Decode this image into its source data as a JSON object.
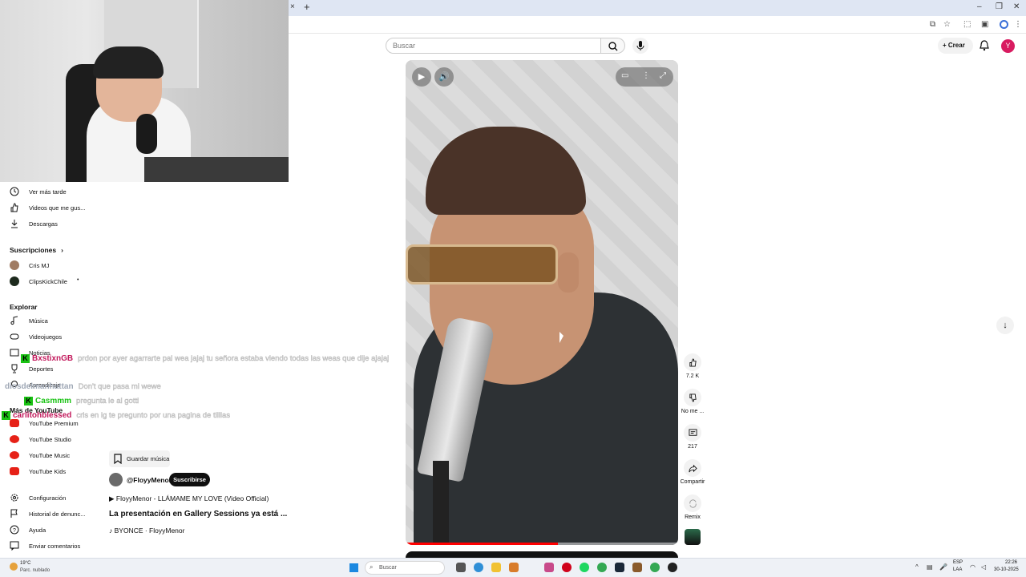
{
  "browser": {
    "close_tab_glyph": "×",
    "new_tab_glyph": "+"
  },
  "header": {
    "search_placeholder": "Buscar",
    "create_label": "Crear",
    "avatar_letter": "Y"
  },
  "sidebar": {
    "personal_items": [
      {
        "label": "Ver más tarde",
        "icon": "clock-icon"
      },
      {
        "label": "Videos que me gus...",
        "icon": "thumbs-up-icon"
      },
      {
        "label": "Descargas",
        "icon": "download-icon"
      }
    ],
    "subscriptions_heading": "Suscripciones",
    "subscriptions": [
      {
        "label": "Cris MJ"
      },
      {
        "label": "ClipsKickChile"
      }
    ],
    "explore_heading": "Explorar",
    "explore_items": [
      {
        "label": "Música",
        "icon": "music-note-icon"
      },
      {
        "label": "Videojuegos",
        "icon": "gamepad-icon"
      },
      {
        "label": "Noticias",
        "icon": "news-icon"
      },
      {
        "label": "Deportes",
        "icon": "trophy-icon"
      },
      {
        "label": "Aprendizaje",
        "icon": "lightbulb-icon"
      }
    ],
    "more_heading": "Más de YouTube",
    "more_items": [
      {
        "label": "YouTube Premium"
      },
      {
        "label": "YouTube Studio"
      },
      {
        "label": "YouTube Music"
      },
      {
        "label": "YouTube Kids"
      }
    ],
    "footer_items": [
      {
        "label": "Configuración",
        "icon": "gear-icon"
      },
      {
        "label": "Historial de denunc...",
        "icon": "flag-icon"
      },
      {
        "label": "Ayuda",
        "icon": "help-icon"
      },
      {
        "label": "Enviar comentarios",
        "icon": "feedback-icon"
      }
    ]
  },
  "chat": [
    {
      "user": "BxstixnGB",
      "color": "#c2185b",
      "msg": "prdon por ayer agarrarte pal wea jajaj tu señora estaba viendo todas las weas que dije ajajaj"
    },
    {
      "user": "diosdelmanhattan",
      "color": "#9ea7b5",
      "msg": "Don't que pasa mi wewe"
    },
    {
      "user": "Casmmm",
      "color": "#19c213",
      "msg": "pregunta le al gotti"
    },
    {
      "user": "carlitohblessed",
      "color": "#c2185b",
      "msg": "cris en ig te pregunto por una pagina de tilllas"
    }
  ],
  "video_info": {
    "save_music_label": "Guardar música",
    "channel_handle": "@FloyyMenor",
    "subscribe_label": "Suscribirse",
    "song_link": "▶ FloyyMenor - LLÁMAME MY LOVE (Video Official)",
    "description": "La presentación en Gallery Sessions ya está ...",
    "audio_credit": "♪ BYONCE · FloyyMenor"
  },
  "player": {
    "progress_fraction": 0.56
  },
  "actions": {
    "likes": "7.2 K",
    "dislike_label": "No me ...",
    "comments": "217",
    "share_label": "Compartir",
    "remix_label": "Remix"
  },
  "taskbar": {
    "weather_temp": "19°C",
    "weather_desc": "Parc. nublado",
    "search_label": "Buscar",
    "lang_code": "ESP",
    "lang_layout": "LAA",
    "time": "22:26",
    "date": "30-10-2025"
  }
}
